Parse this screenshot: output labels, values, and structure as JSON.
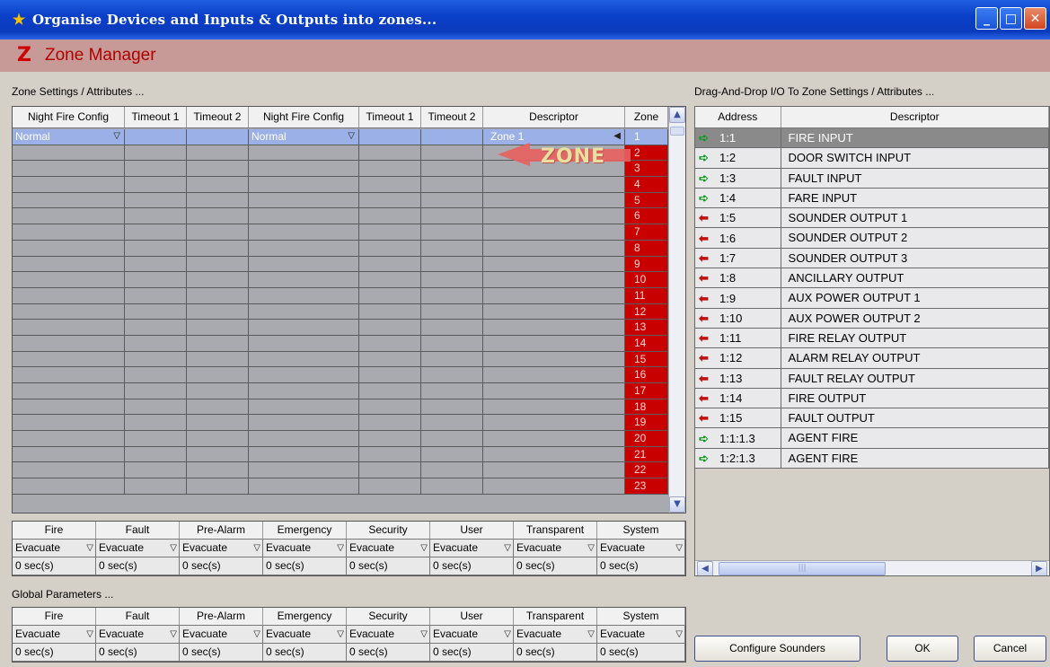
{
  "window": {
    "title": "Organise Devices and Inputs & Outputs into zones...",
    "min": "_",
    "max": "□",
    "close": "✕"
  },
  "header": {
    "title": "Zone Manager"
  },
  "labels": {
    "zone_settings": "Zone Settings / Attributes ...",
    "drag_drop": "Drag-And-Drop I/O To Zone Settings / Attributes ...",
    "global_params": "Global Parameters ..."
  },
  "zone_grid": {
    "columns": [
      "Night Fire Config",
      "Timeout 1",
      "Timeout 2",
      "Night Fire Config",
      "Timeout 1",
      "Timeout 2",
      "Descriptor",
      "Zone"
    ],
    "selected_row": {
      "night_fire_config_1": "Normal",
      "night_fire_config_2": "Normal",
      "descriptor": "Zone 1"
    },
    "zones": [
      "1",
      "2",
      "3",
      "4",
      "5",
      "6",
      "7",
      "8",
      "9",
      "10",
      "11",
      "12",
      "13",
      "14",
      "15",
      "16",
      "17",
      "18",
      "19",
      "20",
      "21",
      "22",
      "23"
    ],
    "drag_tag": "ZONE"
  },
  "zone_actions": {
    "columns": [
      "Fire",
      "Fault",
      "Pre-Alarm",
      "Emergency",
      "Security",
      "User",
      "Transparent",
      "System"
    ],
    "action": "Evacuate",
    "delay": "0 sec(s)"
  },
  "global_params": {
    "columns": [
      "Fire",
      "Fault",
      "Pre-Alarm",
      "Emergency",
      "Security",
      "User",
      "Transparent",
      "System"
    ],
    "action": "Evacuate",
    "delay": "0 sec(s)"
  },
  "io_list": {
    "columns": [
      "Address",
      "Descriptor"
    ],
    "rows": [
      {
        "dir": "in",
        "address": "1:1",
        "descriptor": "FIRE INPUT"
      },
      {
        "dir": "in",
        "address": "1:2",
        "descriptor": "DOOR SWITCH INPUT"
      },
      {
        "dir": "in",
        "address": "1:3",
        "descriptor": "FAULT INPUT"
      },
      {
        "dir": "in",
        "address": "1:4",
        "descriptor": "FARE INPUT"
      },
      {
        "dir": "out",
        "address": "1:5",
        "descriptor": "SOUNDER OUTPUT 1"
      },
      {
        "dir": "out",
        "address": "1:6",
        "descriptor": "SOUNDER OUTPUT 2"
      },
      {
        "dir": "out",
        "address": "1:7",
        "descriptor": "SOUNDER OUTPUT 3"
      },
      {
        "dir": "out",
        "address": "1:8",
        "descriptor": "ANCILLARY OUTPUT"
      },
      {
        "dir": "out",
        "address": "1:9",
        "descriptor": "AUX POWER OUTPUT 1"
      },
      {
        "dir": "out",
        "address": "1:10",
        "descriptor": "AUX POWER OUTPUT 2"
      },
      {
        "dir": "out",
        "address": "1:11",
        "descriptor": "FIRE RELAY OUTPUT"
      },
      {
        "dir": "out",
        "address": "1:12",
        "descriptor": "ALARM RELAY OUTPUT"
      },
      {
        "dir": "out",
        "address": "1:13",
        "descriptor": "FAULT RELAY OUTPUT"
      },
      {
        "dir": "out",
        "address": "1:14",
        "descriptor": "FIRE OUTPUT"
      },
      {
        "dir": "out",
        "address": "1:15",
        "descriptor": "FAULT OUTPUT"
      },
      {
        "dir": "in",
        "address": "1:1:1.3",
        "descriptor": "AGENT FIRE"
      },
      {
        "dir": "in",
        "address": "1:2:1.3",
        "descriptor": "AGENT FIRE"
      }
    ]
  },
  "buttons": {
    "configure_sounders": "Configure Sounders",
    "ok": "OK",
    "cancel": "Cancel"
  },
  "colors": {
    "titlebar": "#0b3bbd",
    "header_band": "#c79a98",
    "zone_red": "#c80000",
    "selection": "#9ab0e6"
  }
}
